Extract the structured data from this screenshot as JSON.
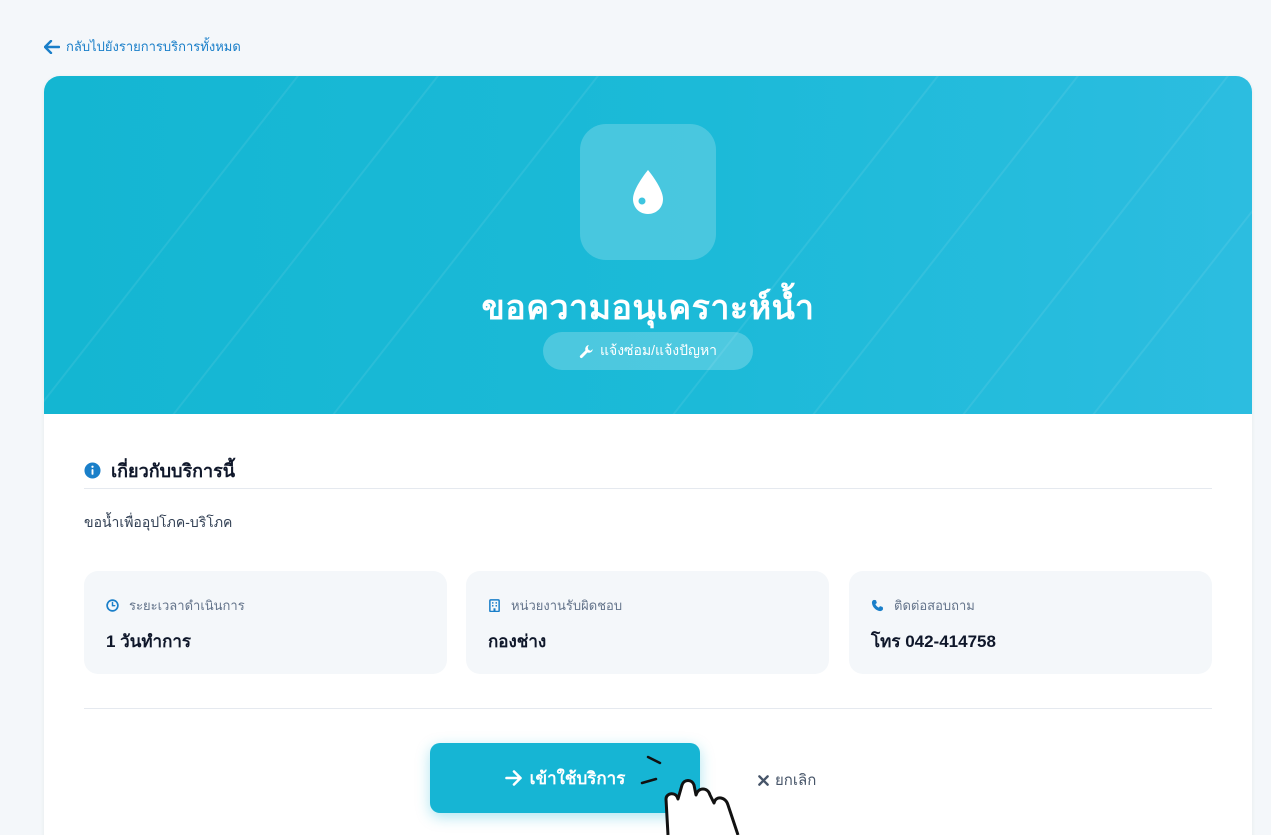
{
  "back_link": {
    "label": "กลับไปยังรายการบริการทั้งหมด"
  },
  "hero": {
    "icon": "water-drop-icon",
    "title": "ขอความอนุเคราะห์น้ำ",
    "category_icon": "wrench-icon",
    "category": "แจ้งซ่อม/แจ้งปัญหา"
  },
  "about": {
    "icon": "info-circle-icon",
    "heading": "เกี่ยวกับบริการนี้",
    "description": "ขอน้ำเพื่ออุปโภค-บริโภค"
  },
  "info": [
    {
      "icon": "clock-icon",
      "label": "ระยะเวลาดำเนินการ",
      "value": "1 วันทำการ"
    },
    {
      "icon": "building-icon",
      "label": "หน่วยงานรับผิดชอบ",
      "value": "กองช่าง"
    },
    {
      "icon": "phone-icon",
      "label": "ติดต่อสอบถาม",
      "value": "โทร 042-414758"
    }
  ],
  "actions": {
    "primary_icon": "arrow-right-icon",
    "primary_label": "เข้าใช้บริการ",
    "cancel_icon": "close-icon",
    "cancel_label": "ยกเลิก"
  },
  "colors": {
    "accent": "#16b5d4",
    "link": "#1a7fc9",
    "info_icon": "#1a7fc9"
  }
}
